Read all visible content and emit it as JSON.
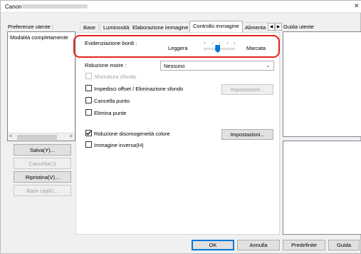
{
  "window": {
    "title": "Canon",
    "close_glyph": "✕"
  },
  "left": {
    "user_prefs_label": "Preferenze utente :",
    "list_item": "Modalità completamente",
    "buttons": {
      "save": "Salva(Y)...",
      "cancel": "Cancella(J)",
      "restore": "Ripristina(V)...",
      "backup": "Back Up(K)..."
    }
  },
  "tabs": [
    "Base",
    "Luminosità",
    "Elaborazione immagine",
    "Controllo immagine",
    "Alimenta"
  ],
  "active_tab": "Controllo immagine",
  "panel": {
    "edge_label": "Evidenziazione bordi :",
    "edge_min": "Leggera",
    "edge_max": "Marcata",
    "edge_level_fraction": 0.45,
    "moire_label": "Riduzione moire :",
    "moire_value": "Nessuno",
    "bg_smoothing": "Sfumatura sfondo",
    "prevent_offset": "Impedisci offset / Eliminazione sfondo",
    "settings_btn": "Impostazioni...",
    "delete_point": "Cancella punto",
    "remove_dots": "Elimina punte",
    "reduce_uneven": "Riduzione disomogeneità colore",
    "settings_btn2": "Impostazioni...",
    "invert": "Immagine inversa(H)"
  },
  "right": {
    "guide_label": "Guida utente"
  },
  "bottom": {
    "ok": "OK",
    "cancel": "Annulla",
    "defaults": "Predefinite",
    "help": "Guida"
  }
}
